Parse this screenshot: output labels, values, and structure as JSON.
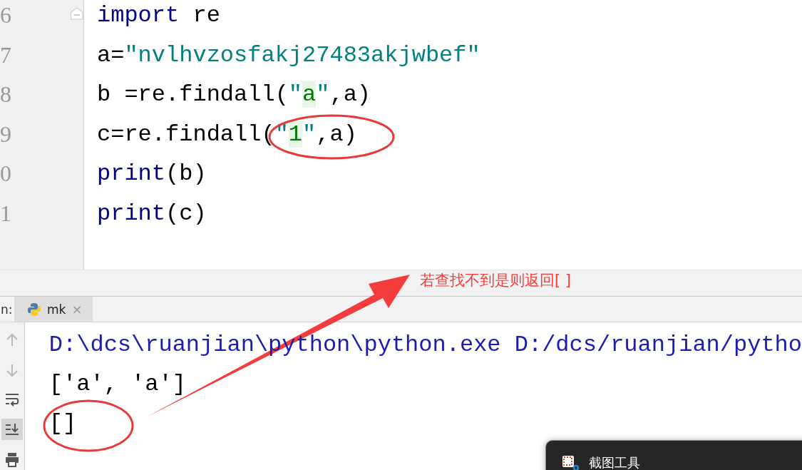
{
  "editor": {
    "lines": [
      {
        "number": "6",
        "tokens": [
          {
            "text": "import",
            "kind": "keyword"
          },
          {
            "text": " re",
            "kind": "plain"
          }
        ]
      },
      {
        "number": "7",
        "tokens": [
          {
            "text": "a=",
            "kind": "plain"
          },
          {
            "text": "\"nvlhvzosfakj27483akjwbef\"",
            "kind": "string"
          }
        ]
      },
      {
        "number": "8",
        "tokens": [
          {
            "text": "b =re.findall(",
            "kind": "plain"
          },
          {
            "text": "\"",
            "kind": "string"
          },
          {
            "text": "a",
            "kind": "match"
          },
          {
            "text": "\"",
            "kind": "string"
          },
          {
            "text": ",a)",
            "kind": "plain"
          }
        ]
      },
      {
        "number": "9",
        "tokens": [
          {
            "text": "c=re.findall(",
            "kind": "plain"
          },
          {
            "text": "\"",
            "kind": "string"
          },
          {
            "text": "1",
            "kind": "match"
          },
          {
            "text": "\"",
            "kind": "string"
          },
          {
            "text": ",a)",
            "kind": "plain"
          }
        ]
      },
      {
        "number": "0",
        "tokens": [
          {
            "text": "print",
            "kind": "keyword"
          },
          {
            "text": "(b)",
            "kind": "plain"
          }
        ]
      },
      {
        "number": "1",
        "tokens": [
          {
            "text": "print",
            "kind": "keyword"
          },
          {
            "text": "(c)",
            "kind": "plain"
          }
        ]
      }
    ]
  },
  "annotation": {
    "text": "若查找不到是则返回[ ]"
  },
  "run_panel": {
    "label": "n:",
    "tab": {
      "title": "mk",
      "close": "×",
      "selected": true
    }
  },
  "toolbar": [
    {
      "kind": "up",
      "selected": false
    },
    {
      "kind": "down",
      "selected": false
    },
    {
      "kind": "wrap",
      "selected": false
    },
    {
      "kind": "scroll-end",
      "selected": true
    },
    {
      "kind": "print",
      "selected": false
    }
  ],
  "console": [
    {
      "text": "D:\\dcs\\ruanjian\\python\\python.exe D:/dcs/ruanjian/pytho",
      "kind": "command"
    },
    {
      "text": "['a', 'a']",
      "kind": "output"
    },
    {
      "text": "[]",
      "kind": "output"
    }
  ],
  "popup": {
    "title": "截图工具"
  }
}
